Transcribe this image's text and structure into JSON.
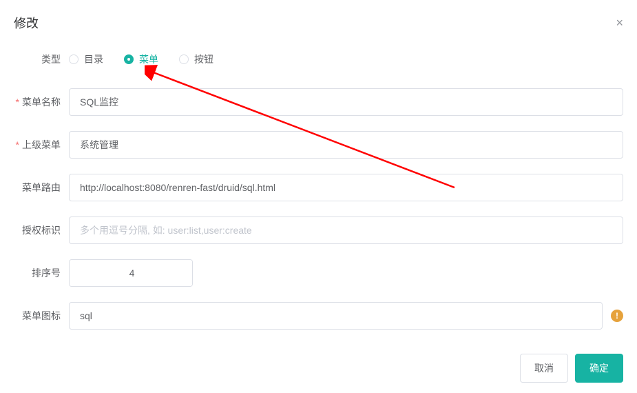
{
  "dialog": {
    "title": "修改",
    "close_icon": "×"
  },
  "form": {
    "type": {
      "label": "类型",
      "options": [
        {
          "label": "目录",
          "selected": false
        },
        {
          "label": "菜单",
          "selected": true
        },
        {
          "label": "按钮",
          "selected": false
        }
      ]
    },
    "name": {
      "label": "菜单名称",
      "value": "SQL监控"
    },
    "parent": {
      "label": "上级菜单",
      "value": "系统管理"
    },
    "route": {
      "label": "菜单路由",
      "value": "http://localhost:8080/renren-fast/druid/sql.html"
    },
    "perm": {
      "label": "授权标识",
      "value": "",
      "placeholder": "多个用逗号分隔, 如: user:list,user:create"
    },
    "order": {
      "label": "排序号",
      "value": "4"
    },
    "icon": {
      "label": "菜单图标",
      "value": "sql"
    }
  },
  "footer": {
    "cancel": "取消",
    "confirm": "确定"
  }
}
